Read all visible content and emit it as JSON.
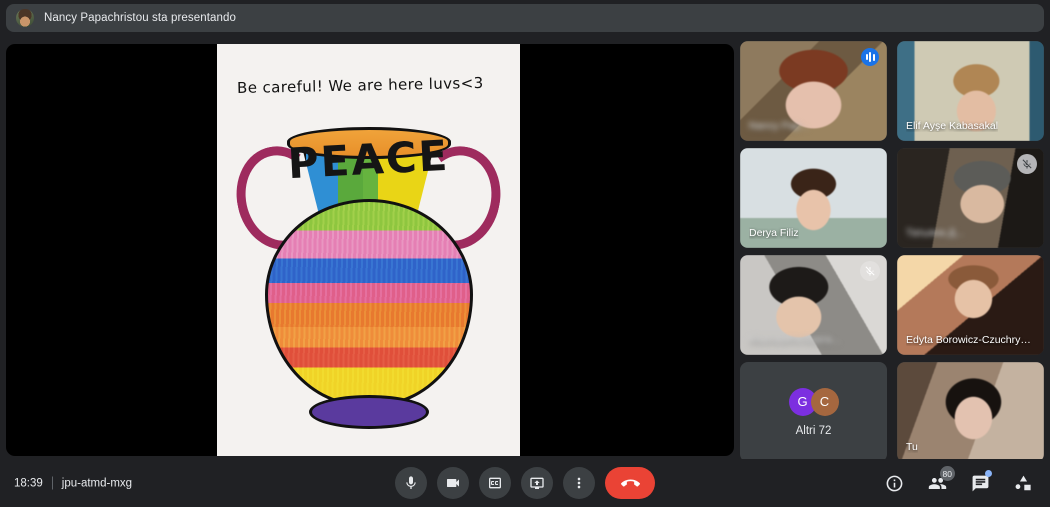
{
  "header": {
    "presenter_notice": "Nancy Papachristou sta presentando",
    "avatar_name": "presenter-avatar"
  },
  "stage": {
    "presentation_caption": "Be careful! We are here luvs<3",
    "artwork_word": "PEACE",
    "background_color": "#000000"
  },
  "tiles": [
    {
      "name": "Nancy Pap...",
      "status": "speaking",
      "icon": "audio-level-icon"
    },
    {
      "name": "Elif Ayşe Kabasakal",
      "status": "none",
      "icon": ""
    },
    {
      "name": "Derya Filiz",
      "status": "none",
      "icon": ""
    },
    {
      "name": "Татьяна Д...",
      "status": "muted",
      "icon": "mic-off-icon"
    },
    {
      "name": "Маргарита Бурга...",
      "status": "muted",
      "icon": "mic-off-icon"
    },
    {
      "name": "Edyta Borowicz-Czuchry…",
      "status": "none",
      "icon": ""
    },
    {
      "name": "Altri 72",
      "status": "overflow",
      "icon": ""
    },
    {
      "name": "Tu",
      "status": "none",
      "icon": ""
    }
  ],
  "overflow_tile": {
    "label": "Altri 72",
    "avatars": [
      {
        "initial": "G",
        "color": "#7c2fe0"
      },
      {
        "initial": "C",
        "color": "#a5673f"
      }
    ]
  },
  "bottom_bar": {
    "time": "18:39",
    "meeting_code": "jpu-atmd-mxg",
    "controls": [
      {
        "label": "Microfono",
        "icon": "microphone-icon"
      },
      {
        "label": "Videocamera",
        "icon": "video-camera-icon"
      },
      {
        "label": "Sottotitoli",
        "icon": "closed-captions-icon"
      },
      {
        "label": "Presenta schermo",
        "icon": "present-screen-icon"
      },
      {
        "label": "Altre opzioni",
        "icon": "more-vertical-icon"
      },
      {
        "label": "Termina chiamata",
        "icon": "end-call-icon"
      }
    ],
    "right_icons": [
      {
        "label": "Dettagli riunione",
        "icon": "info-icon",
        "badge": ""
      },
      {
        "label": "Mostra tutti",
        "icon": "people-icon",
        "badge": "80"
      },
      {
        "label": "Chat",
        "icon": "chat-icon",
        "badge": "dot"
      },
      {
        "label": "Attività",
        "icon": "activities-icon",
        "badge": ""
      }
    ]
  },
  "colors": {
    "accent": "#1a73e8",
    "end_call": "#ea4335",
    "surface": "#3c4043",
    "background": "#202124",
    "chat_dot": "#8ab4f8"
  }
}
